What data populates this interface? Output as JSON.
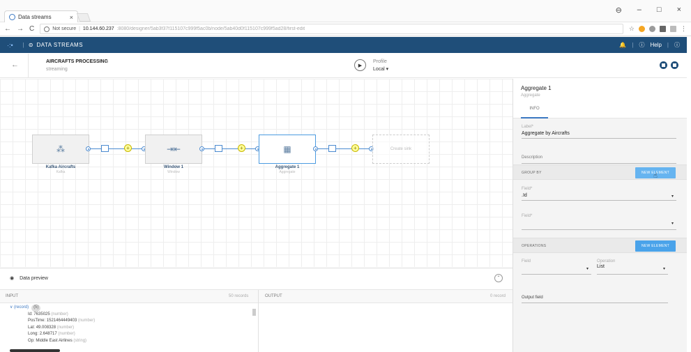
{
  "browser": {
    "tab_title": "Data streams",
    "tab_close": "×",
    "win_min": "–",
    "win_max": "□",
    "win_close": "×",
    "win_account": "⊖",
    "nav_back": "←",
    "nav_forward": "→",
    "nav_reload": "C",
    "security_label": "Not secure",
    "url_host": "10.144.60.237",
    "url_path": ":8080/designer/5ab3f37f115107c999f5ac0b/node/5ab40d0f115107c999f5ad28/first-edit",
    "star": "☆",
    "menu": "⋮",
    "colors": {
      "ext1": "#f5a623",
      "ext2": "#9b9b9b"
    }
  },
  "app": {
    "logo": "·:•",
    "sep": "|",
    "title": "DATA STREAMS",
    "help": "Help",
    "help_icon": "ⓘ",
    "bell": "🔔",
    "info": "ⓘ"
  },
  "pipeline": {
    "back": "←",
    "name": "AIRCRAFTS PROCESSING",
    "edit": "✎",
    "type": "streaming",
    "play": "▶",
    "profile_label": "Profile",
    "profile_value": "Local ▾"
  },
  "canvas": {
    "nodes": [
      {
        "label": "Kafka Aircrafts",
        "sub": "Kafka",
        "glyph": "⁂"
      },
      {
        "label": "Window 1",
        "sub": "Window",
        "glyph": "⇥⇤"
      },
      {
        "label": "Aggregate 1",
        "sub": "Aggregate",
        "glyph": "▦"
      }
    ],
    "placeholder": "Create sink",
    "plus": "+"
  },
  "preview": {
    "title": "Data preview",
    "collapse": "⌃",
    "input_label": "INPUT",
    "input_count": "50 records",
    "output_label": "OUTPUT",
    "output_count": "0 record",
    "records": {
      "root": "∨ (record)",
      "badge": "(5)",
      "fields": [
        {
          "name": "Id:",
          "value": "7635025",
          "type": "(number)"
        },
        {
          "name": "PosTime:",
          "value": "1521464449403",
          "type": "(number)"
        },
        {
          "name": "Lat:",
          "value": "49.008328",
          "type": "(number)"
        },
        {
          "name": "Long:",
          "value": "2.648717",
          "type": "(number)"
        },
        {
          "name": "Op:",
          "value": "Middle East Airlines",
          "type": "(string)"
        }
      ]
    }
  },
  "panel": {
    "title": "Aggregate 1",
    "subtitle": "Aggregate",
    "tab_info": "INFO",
    "label_label": "Label*",
    "label_value": "Aggregate by Aircrafts",
    "description_label": "Description",
    "group_by_label": "GROUP BY",
    "new_element": "NEW ELEMENT",
    "field_label": "Field*",
    "field1_value": ".Id",
    "field2_value": "",
    "caret": "▾",
    "operations_label": "OPERATIONS",
    "op_field_label": "Field",
    "op_operation_label": "Operation",
    "op_operation_value": "List",
    "output_field_label": "Output field",
    "cursor": "☝"
  }
}
